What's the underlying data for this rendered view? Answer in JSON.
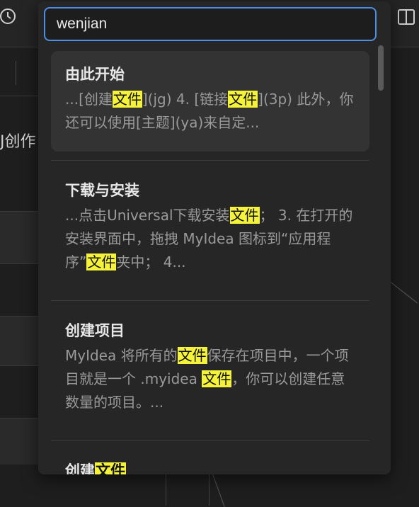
{
  "search": {
    "query": "wenjian"
  },
  "background": {
    "partial_text": "J创作"
  },
  "results": [
    {
      "title": "由此开始",
      "snippet": [
        {
          "t": "...[创建"
        },
        {
          "t": "文件",
          "hl": true
        },
        {
          "t": "](jg) 4. [链接"
        },
        {
          "t": "文件",
          "hl": true
        },
        {
          "t": "](3p) 此外，你还可以使用[主题](ya)来自定..."
        }
      ]
    },
    {
      "title": "下载与安装",
      "snippet": [
        {
          "t": "...点击Universal下载安装"
        },
        {
          "t": "文件",
          "hl": true
        },
        {
          "t": "；  3. 在打开的安装界面中，拖拽 MyIdea 图标到“应用程序”"
        },
        {
          "t": "文件",
          "hl": true
        },
        {
          "t": "夹中；  4..."
        }
      ]
    },
    {
      "title": "创建项目",
      "snippet": [
        {
          "t": "MyIdea 将所有的"
        },
        {
          "t": "文件",
          "hl": true
        },
        {
          "t": "保存在项目中，一个项目就是一个 .myidea "
        },
        {
          "t": "文件",
          "hl": true
        },
        {
          "t": "，你可以创建任意数量的项目。..."
        }
      ]
    },
    {
      "title_parts": [
        {
          "t": "创建"
        },
        {
          "t": "文件",
          "hl": true
        }
      ]
    }
  ],
  "colors": {
    "accent": "#4f8ee6",
    "highlight": "#f5f23a"
  },
  "icons": {
    "history": "clock-icon",
    "layout": "split-view-icon"
  }
}
